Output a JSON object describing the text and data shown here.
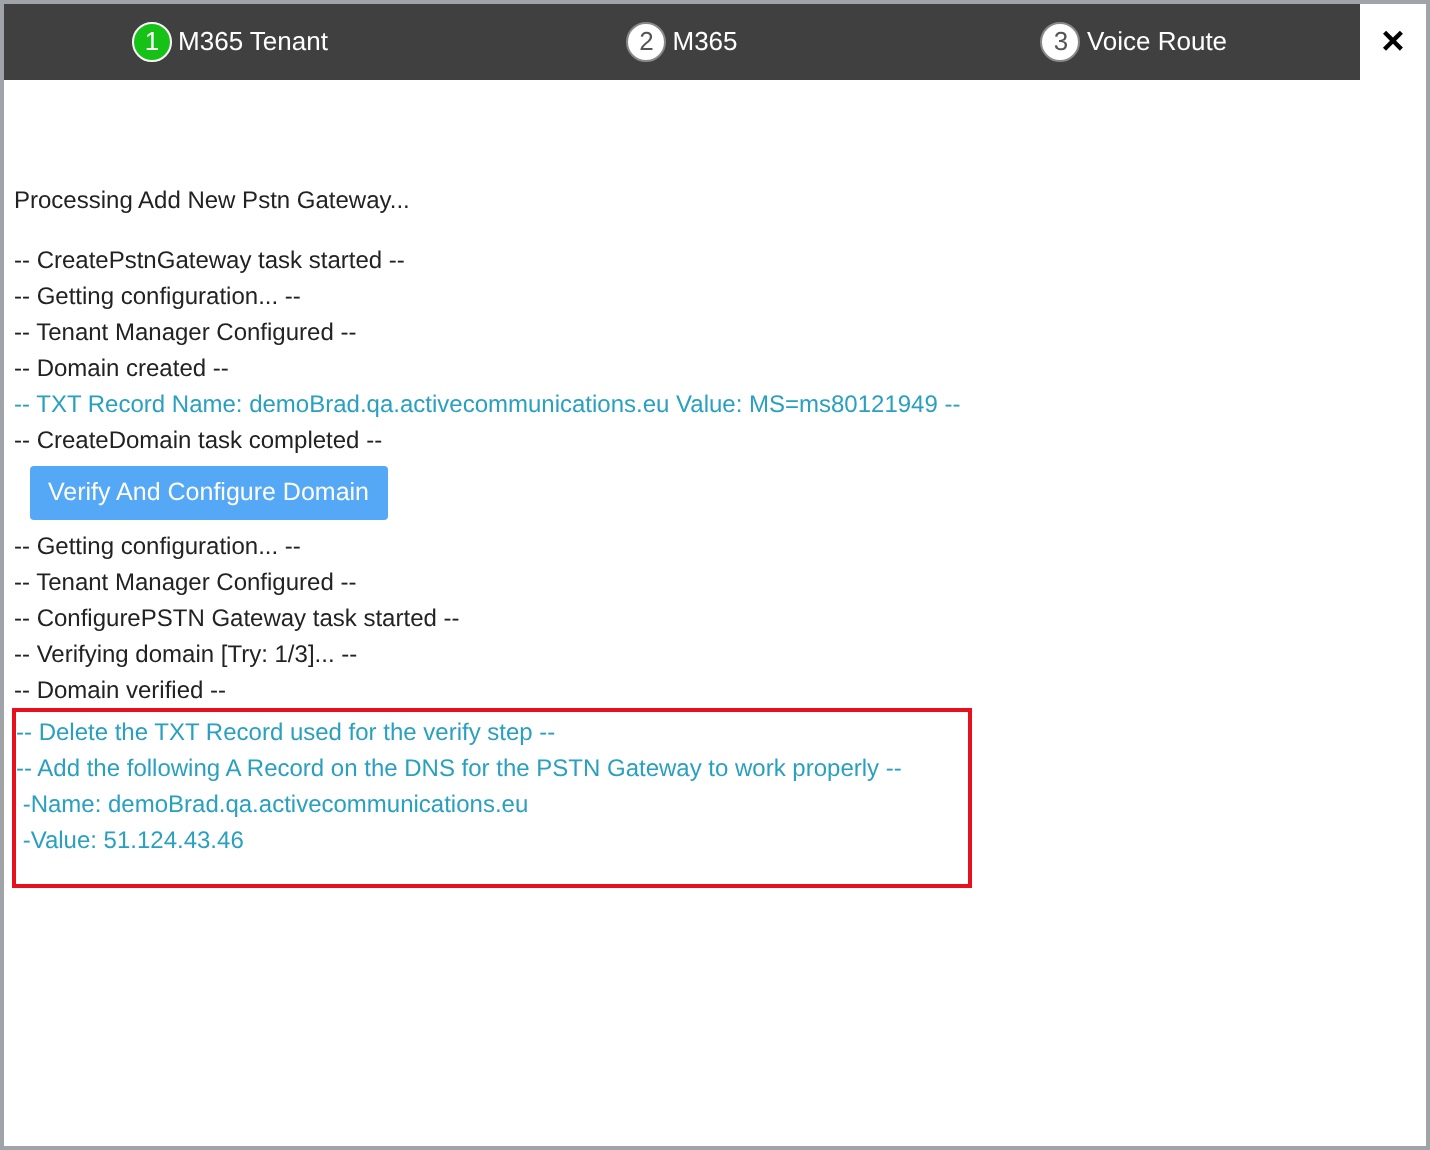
{
  "steps": [
    {
      "number": "1",
      "label": "M365 Tenant",
      "selected": true
    },
    {
      "number": "2",
      "label": "M365",
      "selected": false
    },
    {
      "number": "3",
      "label": "Voice Route",
      "selected": false
    }
  ],
  "close": "×",
  "heading": "Processing Add New Pstn Gateway...",
  "log": [
    {
      "kind": "line",
      "text": "-- CreatePstnGateway task started --",
      "info": false
    },
    {
      "kind": "line",
      "text": "-- Getting configuration... --",
      "info": false
    },
    {
      "kind": "line",
      "text": "-- Tenant Manager Configured --",
      "info": false
    },
    {
      "kind": "line",
      "text": "-- Domain created --",
      "info": false
    },
    {
      "kind": "line",
      "text": "-- TXT Record Name: demoBrad.qa.activecommunications.eu Value: MS=ms80121949 --",
      "info": true
    },
    {
      "kind": "line",
      "text": "-- CreateDomain task completed --",
      "info": false
    },
    {
      "kind": "button",
      "text": "Verify And Configure Domain"
    },
    {
      "kind": "line",
      "text": "-- Getting configuration... --",
      "info": false
    },
    {
      "kind": "line",
      "text": "-- Tenant Manager Configured --",
      "info": false
    },
    {
      "kind": "line",
      "text": "-- ConfigurePSTN Gateway task started --",
      "info": false
    },
    {
      "kind": "line",
      "text": "-- Verifying domain [Try: 1/3]... --",
      "info": false
    },
    {
      "kind": "line",
      "text": "-- Domain verified --",
      "info": false
    },
    {
      "kind": "highlight",
      "lines": [
        {
          "text": "-- Delete the TXT Record used for the verify step --",
          "info": true
        },
        {
          "text": "-- Add the following A Record on the DNS for the PSTN Gateway to work properly --",
          "info": true
        },
        {
          "text": " -Name: demoBrad.qa.activecommunications.eu",
          "info": true
        },
        {
          "text": " -Value: 51.124.43.46",
          "info": true
        }
      ]
    }
  ]
}
